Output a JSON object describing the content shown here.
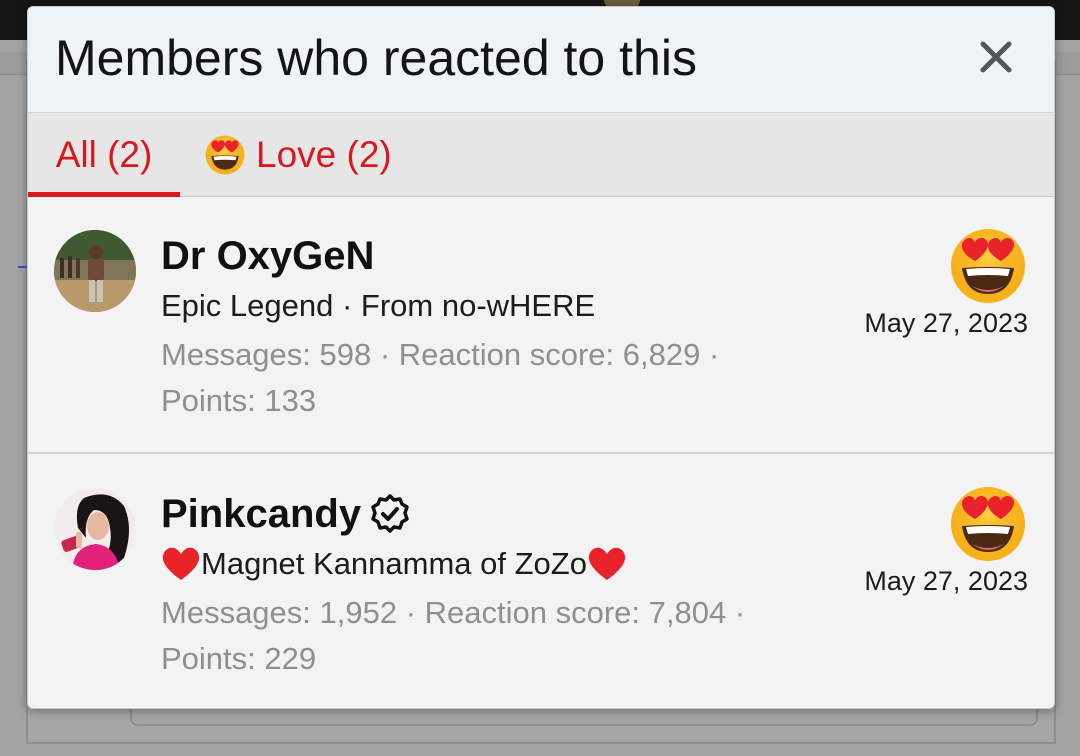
{
  "modal": {
    "title": "Members who reacted to this",
    "close_label": "×"
  },
  "tabs": [
    {
      "label": "All (2)",
      "active": true
    },
    {
      "label": "Love (2)",
      "icon": "heart-eyes-emoji-icon",
      "active": false
    }
  ],
  "members": [
    {
      "username": "Dr OxyGeN",
      "verified": false,
      "title": "Epic Legend · From no-wHERE",
      "stats": "Messages: 598 · Reaction score: 6,829 · Points: 133",
      "reaction_icon": "heart-eyes-emoji-icon",
      "date": "May 27, 2023"
    },
    {
      "username": "Pinkcandy",
      "verified": true,
      "title": "Magnet Kannamma of ZoZo",
      "stats": "Messages: 1,952 · Reaction score: 7,804 · Points: 229",
      "reaction_icon": "heart-eyes-emoji-icon",
      "date": "May 27, 2023"
    }
  ],
  "colors": {
    "accent": "#d8181f",
    "header_bg": "#eef3f8",
    "tab_bg": "#e6e6e6",
    "muted_text": "#8f8f8f"
  }
}
